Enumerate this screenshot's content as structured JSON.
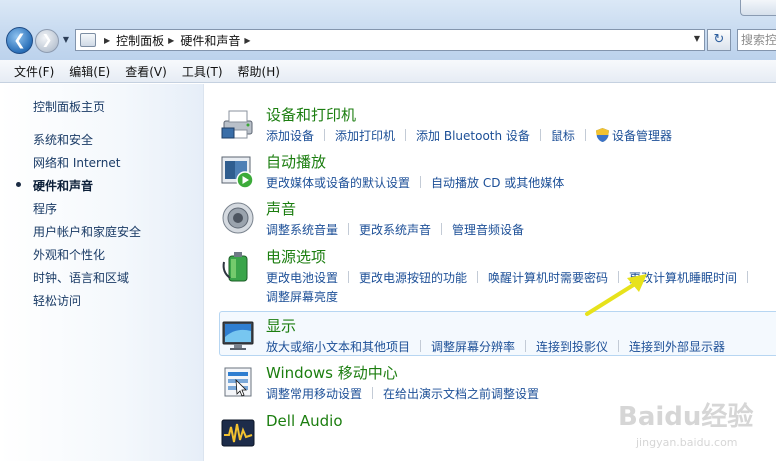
{
  "address_bar": {
    "breadcrumbs": [
      "控制面板",
      "硬件和声音"
    ],
    "search_placeholder": "搜索控"
  },
  "menu": [
    "文件(F)",
    "编辑(E)",
    "查看(V)",
    "工具(T)",
    "帮助(H)"
  ],
  "sidebar": {
    "home": "控制面板主页",
    "items": [
      "系统和安全",
      "网络和 Internet",
      "硬件和声音",
      "程序",
      "用户帐户和家庭安全",
      "外观和个性化",
      "时钟、语言和区域",
      "轻松访问"
    ],
    "current_index": 2
  },
  "categories": [
    {
      "title": "设备和打印机",
      "icon": "printer-icon",
      "links": [
        "添加设备",
        "添加打印机",
        "添加 Bluetooth 设备",
        "鼠标",
        "设备管理器"
      ]
    },
    {
      "title": "自动播放",
      "icon": "autoplay-icon",
      "links": [
        "更改媒体或设备的默认设置",
        "自动播放 CD 或其他媒体"
      ]
    },
    {
      "title": "声音",
      "icon": "speaker-icon",
      "links": [
        "调整系统音量",
        "更改系统声音",
        "管理音频设备"
      ]
    },
    {
      "title": "电源选项",
      "icon": "battery-icon",
      "links": [
        "更改电池设置",
        "更改电源按钮的功能",
        "唤醒计算机时需要密码",
        "更改计算机睡眠时间",
        "调整屏幕亮度"
      ]
    },
    {
      "title": "显示",
      "icon": "display-icon",
      "links": [
        "放大或缩小文本和其他项目",
        "调整屏幕分辨率",
        "连接到投影仪",
        "连接到外部显示器"
      ]
    },
    {
      "title": "Windows 移动中心",
      "icon": "mobility-center-icon",
      "links": [
        "调整常用移动设置",
        "在给出演示文档之前调整设置"
      ]
    },
    {
      "title": "Dell Audio",
      "icon": "dell-audio-icon",
      "links": []
    }
  ],
  "watermark": {
    "logo": "Baidu经验",
    "url": "jingyan.baidu.com"
  },
  "colors": {
    "link": "#1c4f97",
    "title": "#1c7e10",
    "arrow": "#e7e21b"
  }
}
